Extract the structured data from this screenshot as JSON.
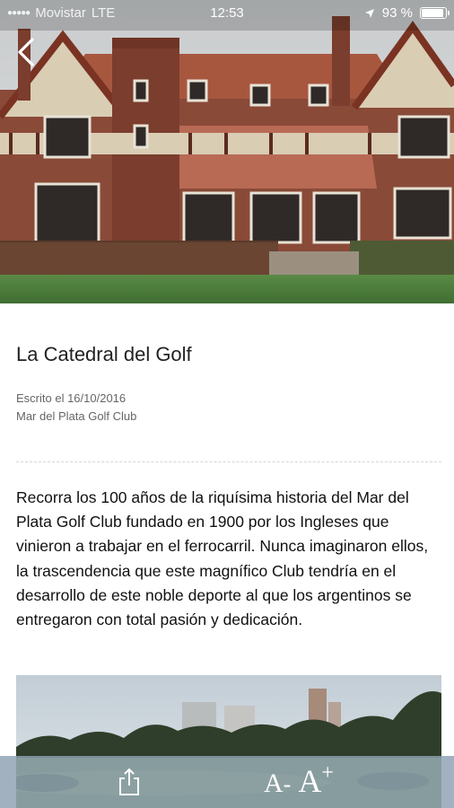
{
  "status_bar": {
    "carrier": "Movistar",
    "network": "LTE",
    "time": "12:53",
    "battery_text": "93 %",
    "battery_level": 0.93
  },
  "article": {
    "title": "La Catedral del Golf",
    "date_line": "Escrito el 16/10/2016",
    "author_line": "Mar del Plata Golf Club",
    "body": "Recorra los 100 años de la riquísima historia del Mar del Plata Golf Club fundado en 1900 por los Ingleses que vinieron a trabajar en el ferrocarril. Nunca imaginaron ellos, la trascendencia que este magnífico Club tendría en el desarrollo de este noble deporte al que los argentinos se entregaron con total pasión y dedicación."
  },
  "toolbar": {
    "font_decrease_label": "A",
    "font_decrease_symbol": "-",
    "font_increase_label": "A",
    "font_increase_symbol": "+"
  },
  "icons": {
    "back": "chevron-left-icon",
    "share": "share-icon",
    "location": "location-arrow-icon",
    "signal": "signal-dots-icon"
  },
  "colors": {
    "toolbar": "#8ca0b2",
    "text": "#222222",
    "meta": "#666666",
    "lawn": "#4a7a3a"
  }
}
